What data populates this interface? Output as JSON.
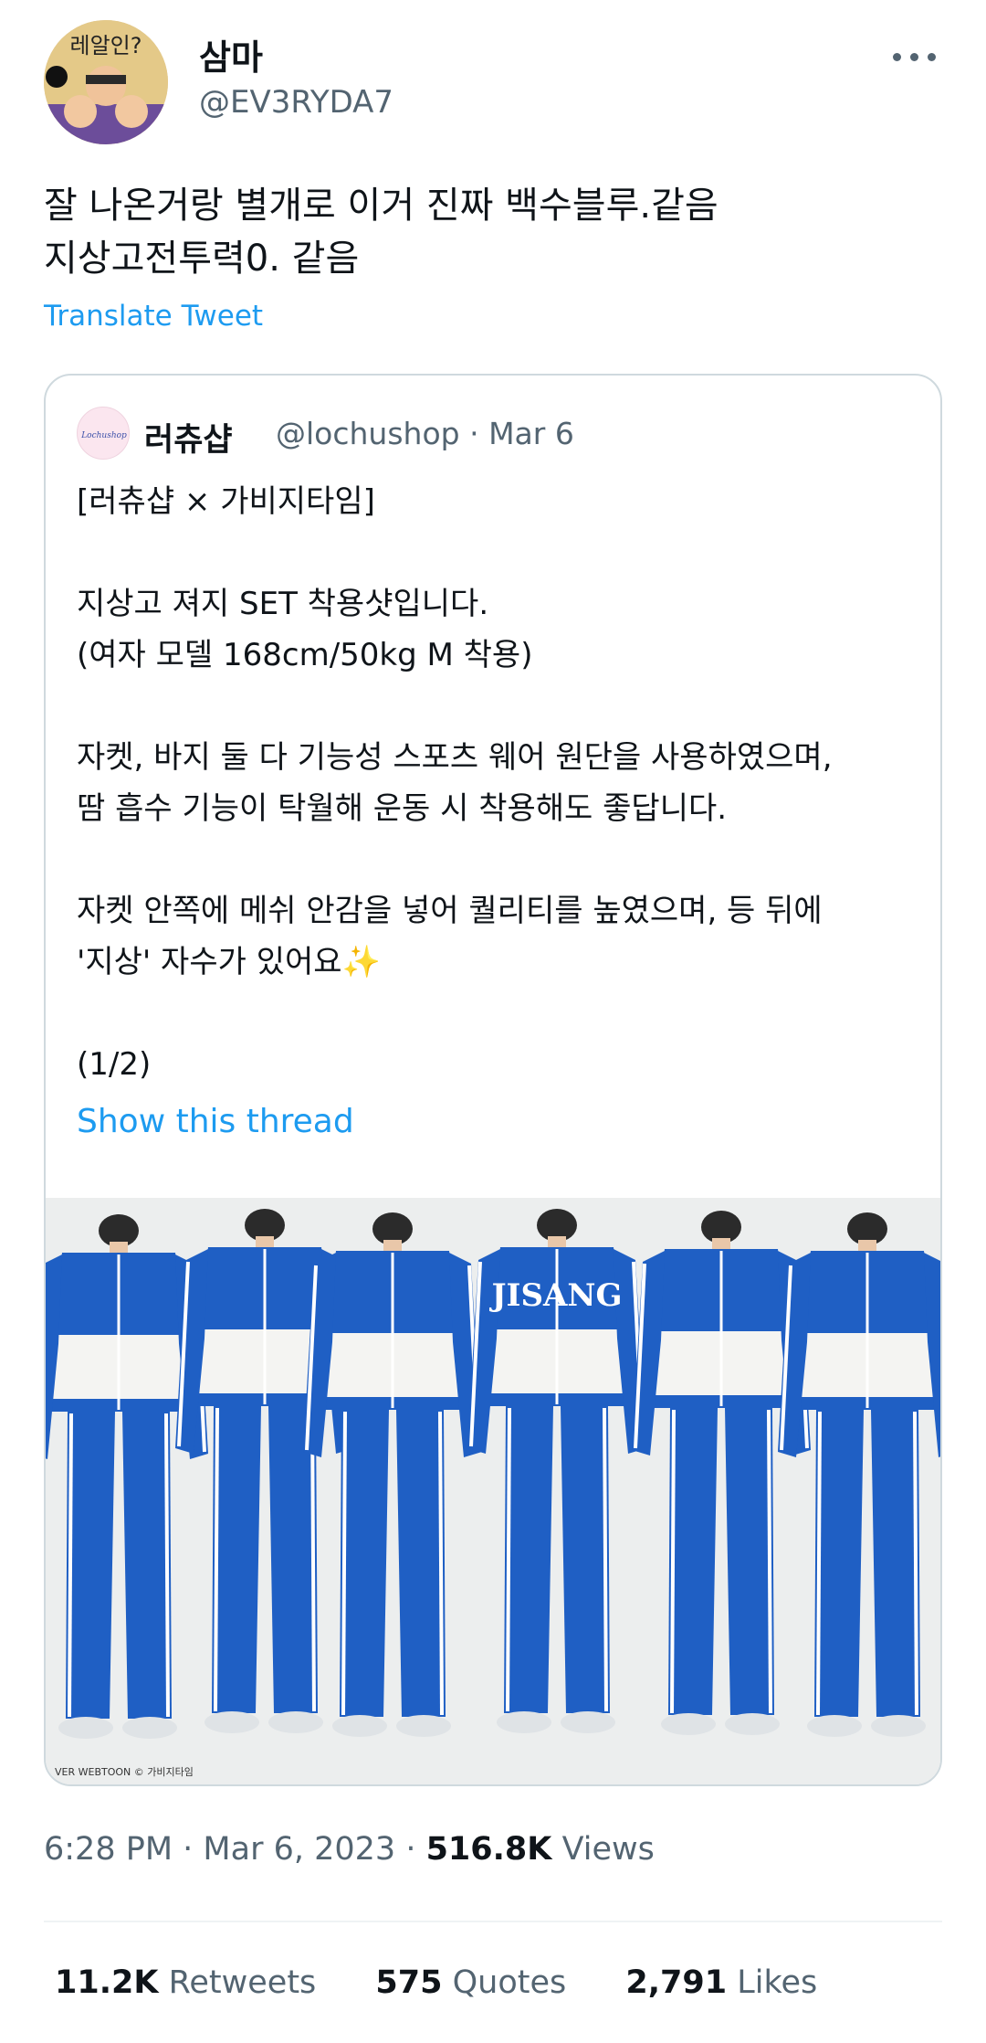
{
  "author": {
    "display_name": "삼마",
    "handle": "@EV3RYDA7",
    "avatar_icon": "profile-avatar-cartoon",
    "avatar_text": "레알인?"
  },
  "tweet": {
    "text": "잘 나온거랑 별개로 이거 진짜 백수블루.같음\n지상고전투력0. 같음",
    "translate_label": "Translate Tweet"
  },
  "quoted": {
    "name": "러츄샵",
    "handle": "@lochushop",
    "date": "Mar 6",
    "avatar_text": "Lochushop",
    "text": "[러츄샵 × 가비지타임]\n\n지상고 져지 SET 착용샷입니다.\n(여자 모델 168cm/50kg M 착용)\n\n자켓, 바지 둘 다 기능성 스포츠 웨어 원단을 사용하였으며,\n땀 흡수 기능이 탁월해 운동 시 착용해도 좋답니다.\n\n자켓 안쪽에 메쉬 안감을 넣어 퀄리티를 높였으며, 등 뒤에\n'지상' 자수가 있어요✨\n\n(1/2)",
    "show_thread_label": "Show this thread",
    "image": {
      "jacket_text": "JISANG",
      "credit": "VER WEBTOON © 가비지타임",
      "colors": {
        "blue": "#1f5fc4",
        "white": "#f4f4f2",
        "background": "#eceeee"
      }
    }
  },
  "meta": {
    "time": "6:28 PM",
    "date": "Mar 6, 2023",
    "views_count": "516.8K",
    "views_label": "Views"
  },
  "stats": {
    "retweets_count": "11.2K",
    "retweets_label": "Retweets",
    "quotes_count": "575",
    "quotes_label": "Quotes",
    "likes_count": "2,791",
    "likes_label": "Likes"
  },
  "colors": {
    "link": "#1d9bf0",
    "secondary_text": "#536471",
    "primary_text": "#0f1419",
    "border": "#cfd9de"
  }
}
